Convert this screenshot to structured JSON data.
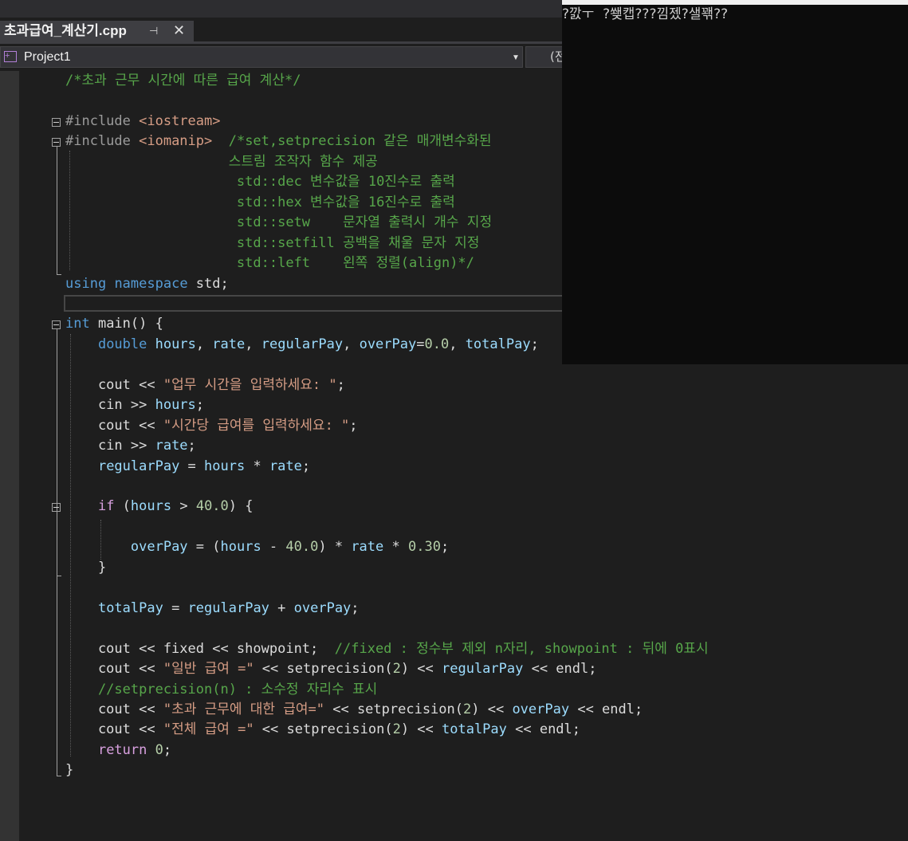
{
  "editor": {
    "tab_title": "초과급여_계산기.cpp",
    "pin_icon": "pin-icon",
    "close_icon": "close-icon",
    "project_dropdown": "Project1",
    "scope_dropdown": "(전",
    "code_lines": [
      [
        [
          "/*초과 근무 시간에 따른 급여 계산*/",
          "#57a64a"
        ]
      ],
      [
        [
          "",
          "#dcdcdc"
        ]
      ],
      [
        [
          "#include ",
          "#9b9b9b"
        ],
        [
          "<iostream>",
          "#d69d85"
        ]
      ],
      [
        [
          "#include ",
          "#9b9b9b"
        ],
        [
          "<iomanip>",
          "#d69d85"
        ],
        [
          "  /*set,setprecision 같은 매개변수화된",
          "#57a64a"
        ]
      ],
      [
        [
          "                    스트림 조작자 함수 제공",
          "#57a64a"
        ]
      ],
      [
        [
          "                     std::dec 변수값을 10진수로 출력",
          "#57a64a"
        ]
      ],
      [
        [
          "                     std::hex 변수값을 16진수로 출력",
          "#57a64a"
        ]
      ],
      [
        [
          "                     std::setw    문자열 출력시 개수 지정",
          "#57a64a"
        ]
      ],
      [
        [
          "                     std::setfill 공백을 채울 문자 지정",
          "#57a64a"
        ]
      ],
      [
        [
          "                     std::left    왼쪽 정렬(align)*/",
          "#57a64a"
        ]
      ],
      [
        [
          "using",
          "#569cd6"
        ],
        [
          " ",
          "#dcdcdc"
        ],
        [
          "namespace",
          "#569cd6"
        ],
        [
          " std;",
          "#dcdcdc"
        ]
      ],
      [
        [
          "",
          "#dcdcdc"
        ]
      ],
      [
        [
          "int",
          "#569cd6"
        ],
        [
          " main() {",
          "#dcdcdc"
        ]
      ],
      [
        [
          "    ",
          "#dcdcdc"
        ],
        [
          "double",
          "#569cd6"
        ],
        [
          " ",
          "#dcdcdc"
        ],
        [
          "hours",
          "#9cdcfe"
        ],
        [
          ", ",
          "#dcdcdc"
        ],
        [
          "rate",
          "#9cdcfe"
        ],
        [
          ", ",
          "#dcdcdc"
        ],
        [
          "regularPay",
          "#9cdcfe"
        ],
        [
          ", ",
          "#dcdcdc"
        ],
        [
          "overPay",
          "#9cdcfe"
        ],
        [
          "=",
          "#dcdcdc"
        ],
        [
          "0.0",
          "#b5cea8"
        ],
        [
          ", ",
          "#dcdcdc"
        ],
        [
          "totalPay",
          "#9cdcfe"
        ],
        [
          ";",
          "#dcdcdc"
        ]
      ],
      [
        [
          "",
          "#dcdcdc"
        ]
      ],
      [
        [
          "    cout << ",
          "#dcdcdc"
        ],
        [
          "\"업무 시간을 입력하세요: \"",
          "#d69d85"
        ],
        [
          ";",
          "#dcdcdc"
        ]
      ],
      [
        [
          "    cin >> ",
          "#dcdcdc"
        ],
        [
          "hours",
          "#9cdcfe"
        ],
        [
          ";",
          "#dcdcdc"
        ]
      ],
      [
        [
          "    cout << ",
          "#dcdcdc"
        ],
        [
          "\"시간당 급여를 입력하세요: \"",
          "#d69d85"
        ],
        [
          ";",
          "#dcdcdc"
        ]
      ],
      [
        [
          "    cin >> ",
          "#dcdcdc"
        ],
        [
          "rate",
          "#9cdcfe"
        ],
        [
          ";",
          "#dcdcdc"
        ]
      ],
      [
        [
          "    ",
          "#dcdcdc"
        ],
        [
          "regularPay",
          "#9cdcfe"
        ],
        [
          " = ",
          "#dcdcdc"
        ],
        [
          "hours",
          "#9cdcfe"
        ],
        [
          " * ",
          "#dcdcdc"
        ],
        [
          "rate",
          "#9cdcfe"
        ],
        [
          ";",
          "#dcdcdc"
        ]
      ],
      [
        [
          "",
          "#dcdcdc"
        ]
      ],
      [
        [
          "    ",
          "#dcdcdc"
        ],
        [
          "if",
          "#d8a0df"
        ],
        [
          " (",
          "#dcdcdc"
        ],
        [
          "hours",
          "#9cdcfe"
        ],
        [
          " > ",
          "#dcdcdc"
        ],
        [
          "40.0",
          "#b5cea8"
        ],
        [
          ") {",
          "#dcdcdc"
        ]
      ],
      [
        [
          "",
          "#dcdcdc"
        ]
      ],
      [
        [
          "        ",
          "#dcdcdc"
        ],
        [
          "overPay",
          "#9cdcfe"
        ],
        [
          " = (",
          "#dcdcdc"
        ],
        [
          "hours",
          "#9cdcfe"
        ],
        [
          " - ",
          "#dcdcdc"
        ],
        [
          "40.0",
          "#b5cea8"
        ],
        [
          ") * ",
          "#dcdcdc"
        ],
        [
          "rate",
          "#9cdcfe"
        ],
        [
          " * ",
          "#dcdcdc"
        ],
        [
          "0.30",
          "#b5cea8"
        ],
        [
          ";",
          "#dcdcdc"
        ]
      ],
      [
        [
          "    }",
          "#dcdcdc"
        ]
      ],
      [
        [
          "",
          "#dcdcdc"
        ]
      ],
      [
        [
          "    ",
          "#dcdcdc"
        ],
        [
          "totalPay",
          "#9cdcfe"
        ],
        [
          " = ",
          "#dcdcdc"
        ],
        [
          "regularPay",
          "#9cdcfe"
        ],
        [
          " + ",
          "#dcdcdc"
        ],
        [
          "overPay",
          "#9cdcfe"
        ],
        [
          ";",
          "#dcdcdc"
        ]
      ],
      [
        [
          "",
          "#dcdcdc"
        ]
      ],
      [
        [
          "    cout << fixed << showpoint;  ",
          "#dcdcdc"
        ],
        [
          "//fixed : 정수부 제외 n자리, showpoint : 뒤에 0표시",
          "#57a64a"
        ]
      ],
      [
        [
          "    cout << ",
          "#dcdcdc"
        ],
        [
          "\"일반 급여 =\"",
          "#d69d85"
        ],
        [
          " << setprecision(",
          "#dcdcdc"
        ],
        [
          "2",
          "#b5cea8"
        ],
        [
          ") << ",
          "#dcdcdc"
        ],
        [
          "regularPay",
          "#9cdcfe"
        ],
        [
          " << endl;",
          "#dcdcdc"
        ]
      ],
      [
        [
          "    //setprecision(n) : 소수정 자리수 표시",
          "#57a64a"
        ]
      ],
      [
        [
          "    cout << ",
          "#dcdcdc"
        ],
        [
          "\"초과 근무에 대한 급여=\"",
          "#d69d85"
        ],
        [
          " << setprecision(",
          "#dcdcdc"
        ],
        [
          "2",
          "#b5cea8"
        ],
        [
          ") << ",
          "#dcdcdc"
        ],
        [
          "overPay",
          "#9cdcfe"
        ],
        [
          " << endl;",
          "#dcdcdc"
        ]
      ],
      [
        [
          "    cout << ",
          "#dcdcdc"
        ],
        [
          "\"전체 급여 =\"",
          "#d69d85"
        ],
        [
          " << setprecision(",
          "#dcdcdc"
        ],
        [
          "2",
          "#b5cea8"
        ],
        [
          ") << ",
          "#dcdcdc"
        ],
        [
          "totalPay",
          "#9cdcfe"
        ],
        [
          " << endl;",
          "#dcdcdc"
        ]
      ],
      [
        [
          "    ",
          "#dcdcdc"
        ],
        [
          "return",
          "#d8a0df"
        ],
        [
          " ",
          "#dcdcdc"
        ],
        [
          "0",
          "#b5cea8"
        ],
        [
          ";",
          "#dcdcdc"
        ]
      ],
      [
        [
          "}",
          "#dcdcdc"
        ]
      ]
    ]
  },
  "console": {
    "output": "?깘ㅜ  ?쐦캡???낌젰?샐꽦??"
  }
}
